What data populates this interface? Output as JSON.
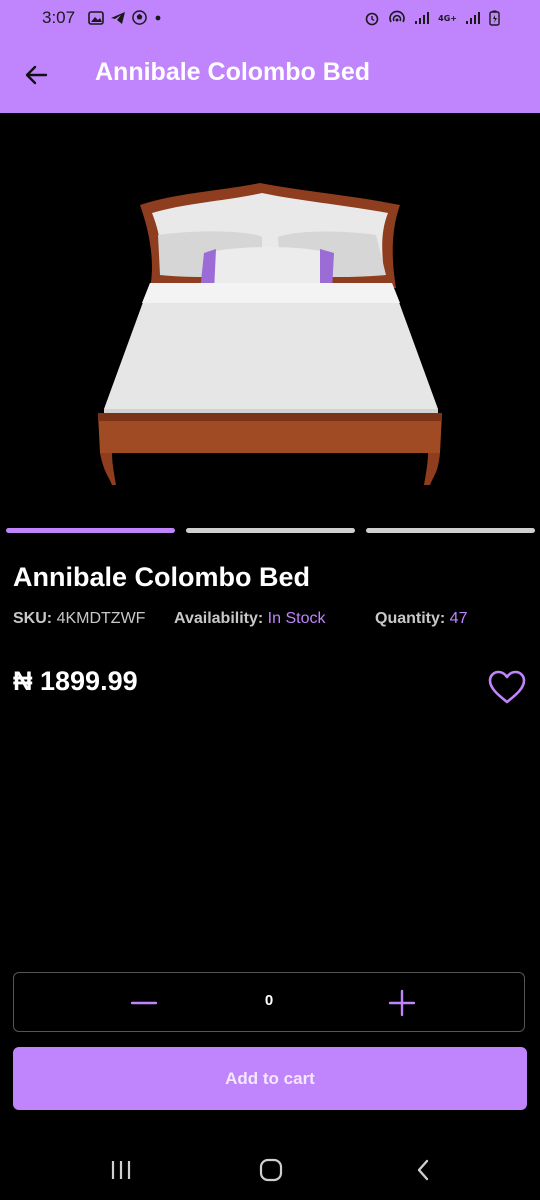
{
  "status_bar": {
    "time": "3:07",
    "icons_left": [
      "gallery-icon",
      "telegram-icon",
      "soccer-ball-icon",
      "dot-icon"
    ],
    "icons_right": [
      "alarm-icon",
      "hotspot-icon",
      "signal-icon",
      "network-4g-icon",
      "signal-icon",
      "battery-icon"
    ],
    "network_label": "4G+"
  },
  "app_bar": {
    "title": "Annibale Colombo Bed",
    "back_icon": "arrow-left-icon",
    "background": "#c084fc"
  },
  "carousel": {
    "image": "bed-product-image",
    "page_count": 3,
    "active_index": 0,
    "active_color": "#c084fc",
    "inactive_color": "#cfcfcf"
  },
  "product": {
    "name": "Annibale Colombo Bed",
    "sku_label": "SKU:",
    "sku_value": "4KMDTZWF",
    "availability_label": "Availability:",
    "availability_value": "In Stock",
    "quantity_label": "Quantity:",
    "quantity_value": "47",
    "price": "₦ 1899.99",
    "favorite_icon": "heart-outline-icon"
  },
  "cart": {
    "quantity": "0",
    "minus_icon": "minus-icon",
    "plus_icon": "plus-icon",
    "add_label": "Add to cart"
  },
  "nav_bar": {
    "recent_icon": "recent-apps-icon",
    "home_icon": "home-icon",
    "back_icon": "back-chevron-icon"
  }
}
